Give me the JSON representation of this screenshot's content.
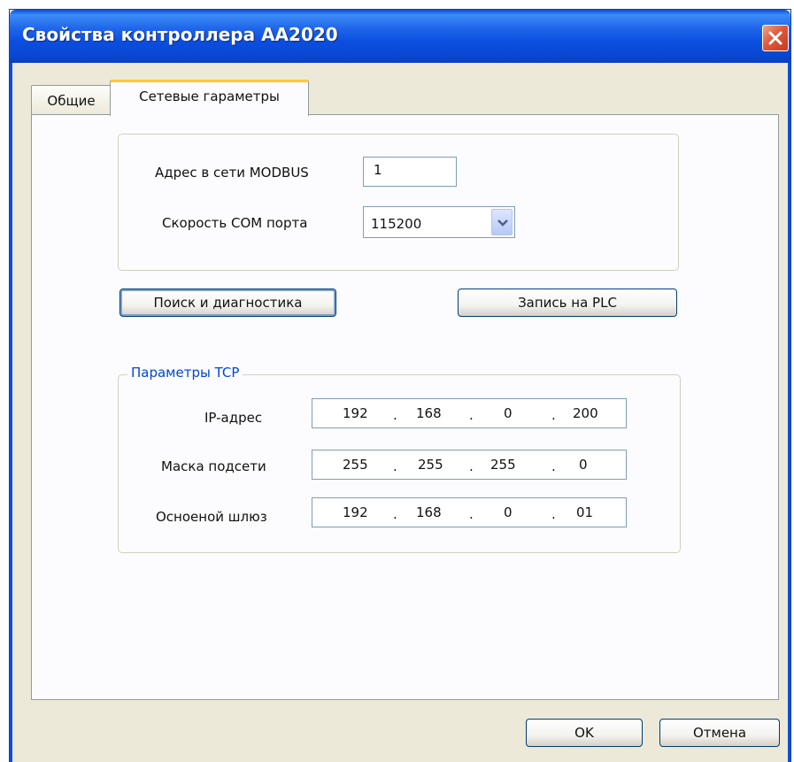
{
  "window": {
    "title": "Свойства контроллера AA2020"
  },
  "tabs": [
    {
      "label": "Общие"
    },
    {
      "label": "Сетевые гараметры"
    }
  ],
  "modbus": {
    "address_label": "Адрес в сети MODBUS",
    "address_value": "1",
    "speed_label": "Скорость COM порта",
    "speed_value": "115200"
  },
  "buttons": {
    "search": "Поиск и диагностика",
    "write": "Запись на PLC",
    "ok": "OK",
    "cancel": "Отмена"
  },
  "tcp": {
    "legend": "Параметры TCP",
    "rows": [
      {
        "label": "IP-адрес",
        "octets": [
          "192",
          "168",
          "0",
          "200"
        ]
      },
      {
        "label": "Маска подсети",
        "octets": [
          "255",
          "255",
          "255",
          "0"
        ]
      },
      {
        "label": "Осноеной шлюз",
        "octets": [
          "192",
          "168",
          "0",
          "01"
        ]
      }
    ]
  },
  "icons": {
    "close": "close-icon",
    "dropdown": "chevron-down-icon"
  },
  "colors": {
    "titlebar": "#0b4ee0",
    "dialog_bg": "#ece9d8",
    "legend_text": "#0046d5",
    "active_tab_accent": "#ffc73c",
    "close_button": "#e0583c"
  }
}
